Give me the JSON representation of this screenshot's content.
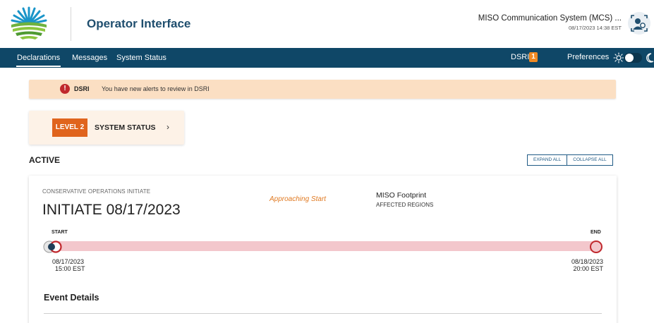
{
  "header": {
    "app_title": "Operator Interface",
    "system_name": "MISO Communication System (MCS) ...",
    "datetime": "08/17/2023 14:38 EST",
    "logo_icon": "sun-fields-logo",
    "user_icon": "user-settings-icon"
  },
  "nav": {
    "items": [
      {
        "label": "Declarations",
        "active": true
      },
      {
        "label": "Messages",
        "active": false
      },
      {
        "label": "System Status",
        "active": false
      }
    ],
    "dsri_label": "DSRI",
    "dsri_count": "1",
    "preferences_label": "Preferences",
    "theme_toggle": {
      "light_icon": "sun-icon",
      "dark_icon": "moon-icon",
      "state": "light"
    }
  },
  "alert": {
    "icon": "exclamation-icon",
    "icon_glyph": "!",
    "title": "DSRI",
    "message": "You have new alerts to review in DSRI"
  },
  "level_card": {
    "badge": "LEVEL 2",
    "label": "SYSTEM STATUS",
    "chevron": "›"
  },
  "active_section": {
    "heading": "ACTIVE",
    "expand_all": "EXPAND ALL",
    "collapse_all": "COLLAPSE ALL"
  },
  "event": {
    "category": "CONSERVATIVE OPERATIONS INITIATE",
    "title": "INITIATE 08/17/2023",
    "status": "Approaching Start",
    "region": "MISO Footprint",
    "region_label": "AFFECTED REGIONS",
    "timeline": {
      "start_label": "START",
      "end_label": "END",
      "start_date": "08/17/2023",
      "start_time": "15:00 EST",
      "end_date": "08/18/2023",
      "end_time": "20:00 EST"
    },
    "details_heading": "Event Details"
  },
  "colors": {
    "navbar": "#0f4767",
    "accent_orange": "#e0641d",
    "alert_bg": "#fbdfc3",
    "timeline_bar": "#f3c7cc",
    "timeline_marker": "#c0282d",
    "title_blue": "#1f4e6e"
  }
}
